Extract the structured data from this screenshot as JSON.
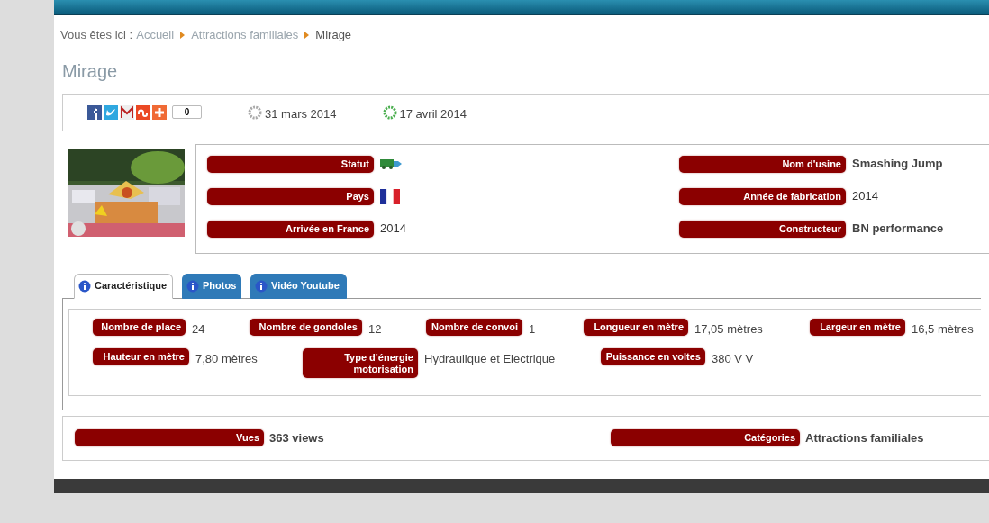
{
  "breadcrumb": {
    "prefix": "Vous êtes ici :",
    "items": [
      {
        "label": "Accueil",
        "current": false
      },
      {
        "label": "Attractions familiales",
        "current": false
      },
      {
        "label": "Mirage",
        "current": true
      }
    ]
  },
  "title": "Mirage",
  "share": {
    "count": "0"
  },
  "dates": [
    {
      "kind": "created",
      "text": "31 mars 2014"
    },
    {
      "kind": "modified",
      "text": "17 avril 2014"
    }
  ],
  "info": {
    "left": [
      {
        "label": "Statut",
        "kind": "truck"
      },
      {
        "label": "Pays",
        "kind": "flag"
      },
      {
        "label": "Arrivée en France",
        "kind": "text",
        "value": "2014"
      }
    ],
    "right": [
      {
        "label": "Nom d'usine",
        "kind": "text",
        "value": "Smashing Jump"
      },
      {
        "label": "Année de fabrication",
        "kind": "text",
        "value": "2014"
      },
      {
        "label": "Constructeur",
        "kind": "text",
        "value": "BN performance"
      }
    ]
  },
  "tabs": [
    {
      "label": "Caractéristique",
      "selected": true
    },
    {
      "label": "Photos",
      "selected": false
    },
    {
      "label": "Vidéo Youtube",
      "selected": false
    }
  ],
  "specs": [
    [
      {
        "label": "Nombre de place",
        "value": "24"
      },
      {
        "label": "Nombre de gondoles",
        "value": "12"
      },
      {
        "label": "Nombre de convoi",
        "value": "1"
      },
      {
        "label": "Longueur en mètre",
        "value": "17,05 mètres"
      },
      {
        "label": "Largeur en mètre",
        "value": "16,5 mètres"
      }
    ],
    [
      {
        "label": "Hauteur en mètre",
        "value": "7,80 mètres"
      },
      {
        "label": "Type d’énergie motorisation",
        "value": "Hydraulique et Electrique"
      },
      {
        "label": "Puissance en voltes",
        "value": "380 V V"
      }
    ]
  ],
  "footer": [
    {
      "label": "Vues",
      "value": "363 views"
    },
    {
      "label": "Catégories",
      "value": "Attractions familiales"
    }
  ]
}
